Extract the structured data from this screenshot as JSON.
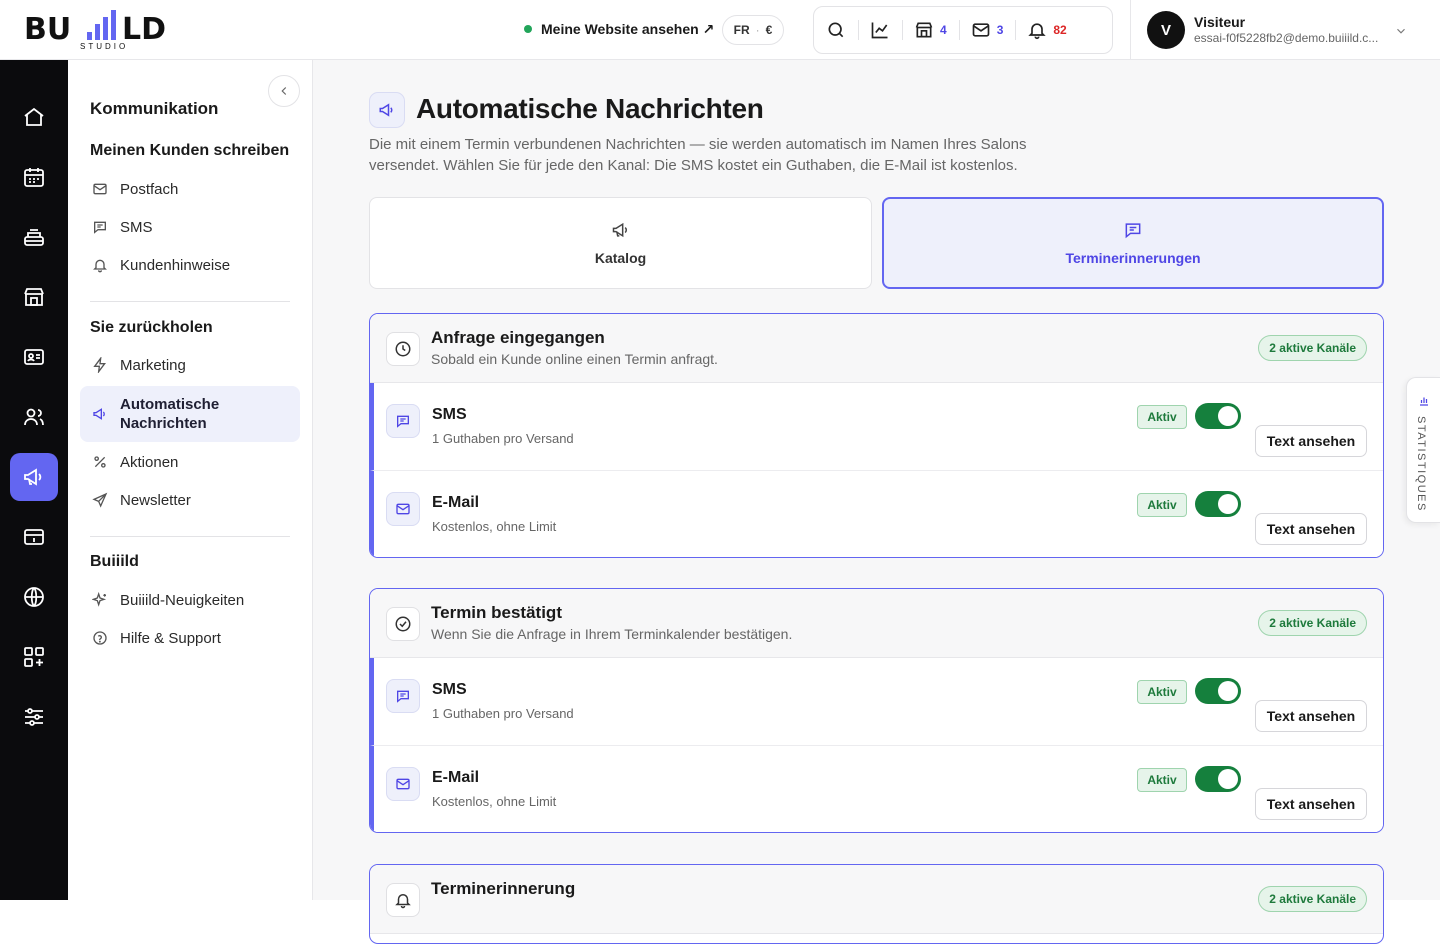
{
  "brand": {
    "logo_text": "BUIIILD",
    "logo_sub": "STUDIO"
  },
  "topbar": {
    "site_link": "Meine Website ansehen ↗",
    "lang": "FR",
    "currency": "€",
    "stores_count": "4",
    "mail_count": "3",
    "notif_count": "82",
    "user_initial": "V",
    "user_name": "Visiteur",
    "user_email": "essai-f0f5228fb2@demo.buiiild.c..."
  },
  "sidebar": {
    "title": "Kommunikation",
    "section1": "Meinen Kunden schreiben",
    "s1_items": [
      "Postfach",
      "SMS",
      "Kundenhinweise"
    ],
    "section2": "Sie zurückholen",
    "s2_items": [
      "Marketing",
      "Automatische Nachrichten",
      "Aktionen",
      "Newsletter"
    ],
    "section3": "Buiiild",
    "s3_items": [
      "Buiiild-Neuigkeiten",
      "Hilfe & Support"
    ]
  },
  "page": {
    "title": "Automatische Nachrichten",
    "description": "Die mit einem Termin verbundenen Nachrichten — sie werden automatisch im Namen Ihres Salons versendet. Wählen Sie für jede den Kanal: Die SMS kostet ein Guthaben, die E-Mail ist kostenlos.",
    "tabs": [
      {
        "label": "Katalog"
      },
      {
        "label": "Terminerinnerungen"
      }
    ]
  },
  "cards": [
    {
      "title": "Anfrage eingegangen",
      "subtitle": "Sobald ein Kunde online einen Termin anfragt.",
      "badge": "2 aktive Kanäle",
      "rows": [
        {
          "title": "SMS",
          "subtitle": "1 Guthaben pro Versand",
          "status": "Aktiv",
          "button": "Text ansehen"
        },
        {
          "title": "E-Mail",
          "subtitle": "Kostenlos, ohne Limit",
          "status": "Aktiv",
          "button": "Text ansehen"
        }
      ]
    },
    {
      "title": "Termin bestätigt",
      "subtitle": "Wenn Sie die Anfrage in Ihrem Terminkalender bestätigen.",
      "badge": "2 aktive Kanäle",
      "rows": [
        {
          "title": "SMS",
          "subtitle": "1 Guthaben pro Versand",
          "status": "Aktiv",
          "button": "Text ansehen"
        },
        {
          "title": "E-Mail",
          "subtitle": "Kostenlos, ohne Limit",
          "status": "Aktiv",
          "button": "Text ansehen"
        }
      ]
    },
    {
      "title": "Terminerinnerung",
      "badge": "2 aktive Kanäle"
    }
  ],
  "stats_tab": "STATISTIQUES",
  "colors": {
    "accent": "#6366f1",
    "active_green": "#15803d",
    "rail": "#0b0b0d"
  }
}
